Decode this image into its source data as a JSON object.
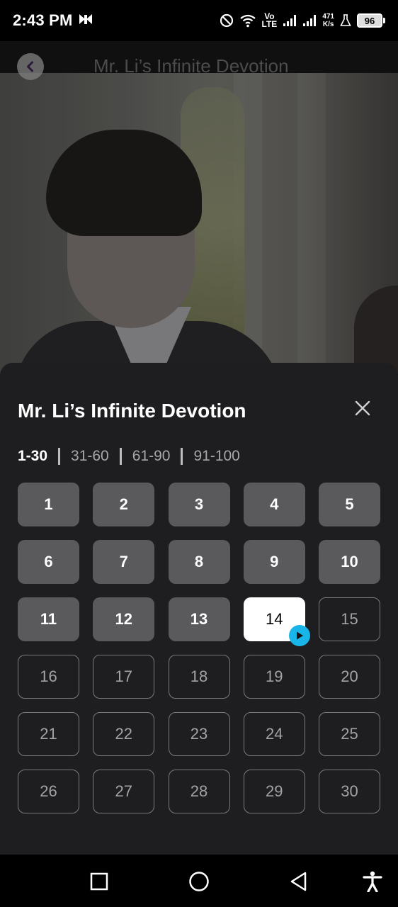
{
  "status_bar": {
    "time": "2:43 PM",
    "network_speed_value": "471",
    "network_speed_unit": "K/s",
    "volte": "Vo",
    "lte": "LTE",
    "battery": "96"
  },
  "video": {
    "title": "Mr. Li’s Infinite Devotion"
  },
  "episode_sheet": {
    "title": "Mr. Li’s Infinite Devotion",
    "ranges": [
      "1-30",
      "31-60",
      "61-90",
      "91-100"
    ],
    "active_range": "1-30",
    "episodes": [
      "1",
      "2",
      "3",
      "4",
      "5",
      "6",
      "7",
      "8",
      "9",
      "10",
      "11",
      "12",
      "13",
      "14",
      "15",
      "16",
      "17",
      "18",
      "19",
      "20",
      "21",
      "22",
      "23",
      "24",
      "25",
      "26",
      "27",
      "28",
      "29",
      "30"
    ],
    "watched": [
      "1",
      "2",
      "3",
      "4",
      "5",
      "6",
      "7",
      "8",
      "9",
      "10",
      "11",
      "12",
      "13"
    ],
    "current": "14",
    "accent_color": "#1ab5e8"
  },
  "nav_bar": {
    "icons": [
      "recents-icon",
      "home-icon",
      "back-icon",
      "accessibility-icon"
    ]
  }
}
